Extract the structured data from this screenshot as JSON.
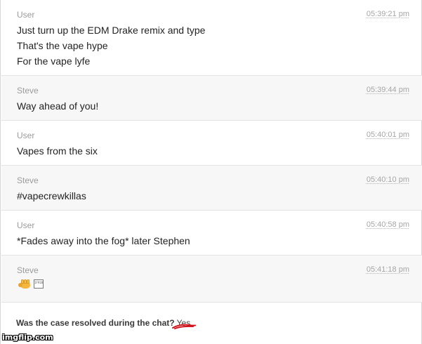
{
  "messages": [
    {
      "sender": "User",
      "time": "05:39:21 pm",
      "lines": [
        "Just turn up the EDM Drake remix and type",
        "That's the vape hype",
        "For the vape lyfe"
      ]
    },
    {
      "sender": "Steve",
      "time": "05:39:44 pm",
      "lines": [
        "Way ahead of you!"
      ]
    },
    {
      "sender": "User",
      "time": "05:40:01 pm",
      "lines": [
        "Vapes from the six"
      ]
    },
    {
      "sender": "Steve",
      "time": "05:40:10 pm",
      "lines": [
        "#vapecrewkillas"
      ]
    },
    {
      "sender": "User",
      "time": "05:40:58 pm",
      "lines": [
        "*Fades away into the fog* later Stephen"
      ]
    },
    {
      "sender": "Steve",
      "time": "05:41:18 pm",
      "emojis": [
        "fist-icon",
        "unknown-glyph-icon"
      ],
      "unknown_glyph_text": "1F91B"
    }
  ],
  "footer": {
    "question": "Was the case resolved during the chat?",
    "answer": "Yes",
    "scribble_color": "#d0121b"
  },
  "watermark": "imgflip.com"
}
